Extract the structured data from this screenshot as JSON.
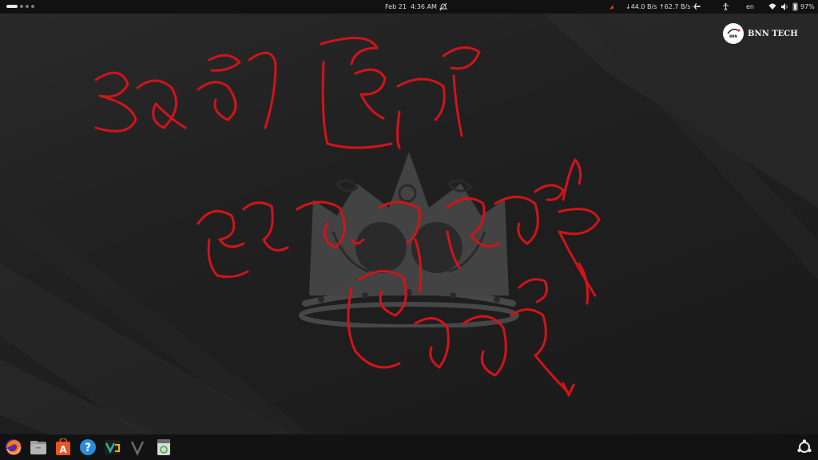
{
  "colors": {
    "panel_bg": "#111111",
    "desktop_bg": "#1f1f1f",
    "scribble_red": "#d1141a",
    "crown_gray": "#4a4a4a"
  },
  "top_bar": {
    "activities_icon": "workspace-indicator-icon",
    "date": "Feb 21",
    "time": "4:36 AM",
    "notifications_icon": "do-not-disturb-icon",
    "indicator_icon": "red-app-indicator-icon",
    "net_speed": "↓44.0 B/s ↑62.7 B/s",
    "tray_icon_1": "airplane-icon",
    "accessibility_icon": "accessibility-icon",
    "keyboard_layout": "en",
    "wifi_icon": "wifi-icon",
    "volume_icon": "volume-icon",
    "battery_icon": "battery-icon",
    "battery_percent": "97%"
  },
  "watermark": {
    "logo_text": "BNN",
    "label": "BNN TECH"
  },
  "dock": {
    "apps": [
      {
        "name": "firefox-icon"
      },
      {
        "name": "files-icon"
      },
      {
        "name": "app-center-icon"
      },
      {
        "name": "help-icon"
      },
      {
        "name": "vscode-icon"
      },
      {
        "name": "vim-icon"
      },
      {
        "name": "trash-icon"
      }
    ],
    "show_apps_icon": "ubuntu-logo-icon"
  }
}
